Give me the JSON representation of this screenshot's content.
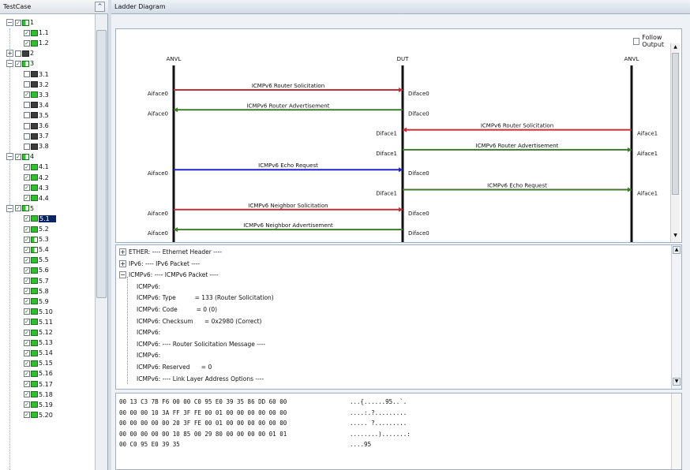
{
  "left_panel": {
    "title": "TestCase",
    "collapse_glyph": "^",
    "items": [
      {
        "label": "1",
        "level": 0,
        "expander": "−",
        "status": "mix",
        "checked": true
      },
      {
        "label": "1.1",
        "level": 1,
        "status": "pass",
        "checked": true
      },
      {
        "label": "1.2",
        "level": 1,
        "status": "pass",
        "checked": true
      },
      {
        "label": "2",
        "level": 0,
        "expander": "+",
        "status": "dark",
        "checked": false
      },
      {
        "label": "3",
        "level": 0,
        "expander": "−",
        "status": "mix",
        "checked": true
      },
      {
        "label": "3.1",
        "level": 1,
        "status": "dark",
        "checked": false
      },
      {
        "label": "3.2",
        "level": 1,
        "status": "dark",
        "checked": false
      },
      {
        "label": "3.3",
        "level": 1,
        "status": "pass",
        "checked": true
      },
      {
        "label": "3.4",
        "level": 1,
        "status": "dark",
        "checked": false
      },
      {
        "label": "3.5",
        "level": 1,
        "status": "dark",
        "checked": false
      },
      {
        "label": "3.6",
        "level": 1,
        "status": "dark",
        "checked": false
      },
      {
        "label": "3.7",
        "level": 1,
        "status": "dark",
        "checked": false
      },
      {
        "label": "3.8",
        "level": 1,
        "status": "dark",
        "checked": false
      },
      {
        "label": "4",
        "level": 0,
        "expander": "−",
        "status": "mix",
        "checked": true
      },
      {
        "label": "4.1",
        "level": 1,
        "status": "pass",
        "checked": true
      },
      {
        "label": "4.2",
        "level": 1,
        "status": "pass",
        "checked": true
      },
      {
        "label": "4.3",
        "level": 1,
        "status": "pass",
        "checked": true
      },
      {
        "label": "4.4",
        "level": 1,
        "status": "pass",
        "checked": true
      },
      {
        "label": "5",
        "level": 0,
        "expander": "−",
        "status": "mix",
        "checked": true
      },
      {
        "label": "5.1",
        "level": 1,
        "status": "pass",
        "checked": true,
        "selected": true
      },
      {
        "label": "5.2",
        "level": 1,
        "status": "pass",
        "checked": true
      },
      {
        "label": "5.3",
        "level": 1,
        "status": "mix",
        "checked": true
      },
      {
        "label": "5.4",
        "level": 1,
        "status": "mix",
        "checked": true
      },
      {
        "label": "5.5",
        "level": 1,
        "status": "pass",
        "checked": true
      },
      {
        "label": "5.6",
        "level": 1,
        "status": "pass",
        "checked": true
      },
      {
        "label": "5.7",
        "level": 1,
        "status": "pass",
        "checked": true
      },
      {
        "label": "5.8",
        "level": 1,
        "status": "pass",
        "checked": true
      },
      {
        "label": "5.9",
        "level": 1,
        "status": "pass",
        "checked": true
      },
      {
        "label": "5.10",
        "level": 1,
        "status": "pass",
        "checked": true
      },
      {
        "label": "5.11",
        "level": 1,
        "status": "pass",
        "checked": true
      },
      {
        "label": "5.12",
        "level": 1,
        "status": "pass",
        "checked": true
      },
      {
        "label": "5.13",
        "level": 1,
        "status": "pass",
        "checked": true
      },
      {
        "label": "5.14",
        "level": 1,
        "status": "pass",
        "checked": true
      },
      {
        "label": "5.15",
        "level": 1,
        "status": "pass",
        "checked": true
      },
      {
        "label": "5.16",
        "level": 1,
        "status": "pass",
        "checked": true
      },
      {
        "label": "5.17",
        "level": 1,
        "status": "pass",
        "checked": true
      },
      {
        "label": "5.18",
        "level": 1,
        "status": "pass",
        "checked": true
      },
      {
        "label": "5.19",
        "level": 1,
        "status": "pass",
        "checked": true
      },
      {
        "label": "5.20",
        "level": 1,
        "status": "pass",
        "checked": true
      }
    ]
  },
  "right_panel": {
    "title": "Ladder Diagram",
    "follow_output_label": "Follow Output",
    "ladder": {
      "lifelines": [
        "ANVL",
        "DUT",
        "ANVL"
      ],
      "colors": {
        "red": "#c0303a",
        "green": "#3f7a2a",
        "blue": "#2424c8"
      },
      "messages": [
        {
          "label": "ICMPv6 Router Solicitation",
          "from": 0,
          "to": 1,
          "color": "red",
          "left": "Aiface0",
          "right": "Diface0"
        },
        {
          "label": "ICMPv6 Router Advertisement",
          "from": 1,
          "to": 0,
          "color": "green",
          "left": "Aiface0",
          "right": "Diface0"
        },
        {
          "label": "ICMPv6 Router Solicitation",
          "from": 2,
          "to": 1,
          "color": "red",
          "left": "Diface1",
          "right": "Aiface1"
        },
        {
          "label": "ICMPv6 Router Advertisement",
          "from": 1,
          "to": 2,
          "color": "green",
          "left": "Diface1",
          "right": "Aiface1"
        },
        {
          "label": "ICMPv6 Echo Request",
          "from": 0,
          "to": 1,
          "color": "blue",
          "left": "Aiface0",
          "right": "Diface0"
        },
        {
          "label": "ICMPv6 Echo Request",
          "from": 1,
          "to": 2,
          "color": "green",
          "left": "Diface1",
          "right": "Aiface1"
        },
        {
          "label": "ICMPv6 Neighbor Solicitation",
          "from": 0,
          "to": 1,
          "color": "red",
          "left": "Aiface0",
          "right": "Diface0"
        },
        {
          "label": "ICMPv6 Neighbor Advertisement",
          "from": 1,
          "to": 0,
          "color": "green",
          "left": "Aiface0",
          "right": "Diface0"
        }
      ]
    },
    "decode": {
      "lines": [
        {
          "indent": 0,
          "expander": "+",
          "text": "ETHER: ---- Ethernet Header ----"
        },
        {
          "indent": 0,
          "expander": "+",
          "text": "IPv6: ---- IPv6 Packet ----"
        },
        {
          "indent": 0,
          "expander": "−",
          "text": "ICMPv6: ---- ICMPv6 Packet ----"
        },
        {
          "indent": 1,
          "text": "ICMPv6:"
        },
        {
          "indent": 1,
          "text": "ICMPv6: Type          = 133 (Router Solicitation)"
        },
        {
          "indent": 1,
          "text": "ICMPv6: Code          = 0 (0)"
        },
        {
          "indent": 1,
          "text": "ICMPv6: Checksum      = 0x2980 (Correct)"
        },
        {
          "indent": 1,
          "text": "ICMPv6:"
        },
        {
          "indent": 1,
          "text": "ICMPv6: ---- Router Solicitation Message ----"
        },
        {
          "indent": 1,
          "text": "ICMPv6:"
        },
        {
          "indent": 1,
          "text": "ICMPv6: Reserved      = 0"
        },
        {
          "indent": 1,
          "text": "ICMPv6: ---- Link Layer Address Options ----"
        }
      ]
    },
    "hex": {
      "rows": [
        {
          "bytes": "00 13 C3 7B F6 00 00 C0 95 E0 39 35 86 DD 60 00",
          "ascii": "...{......95..`."
        },
        {
          "bytes": "00 00 00 10 3A FF 3F FE 00 01 00 00 00 00 00 00",
          "ascii": "....:.?........."
        },
        {
          "bytes": "00 00 00 00 00 20 3F FE 00 01 00 00 00 00 00 00",
          "ascii": "..... ?........."
        },
        {
          "bytes": "00 00 00 00 00 10 85 00 29 80 00 00 00 00 01 01",
          "ascii": "........).......:"
        },
        {
          "bytes": "00 C0 95 E0 39 35",
          "ascii": "....95"
        }
      ]
    }
  }
}
